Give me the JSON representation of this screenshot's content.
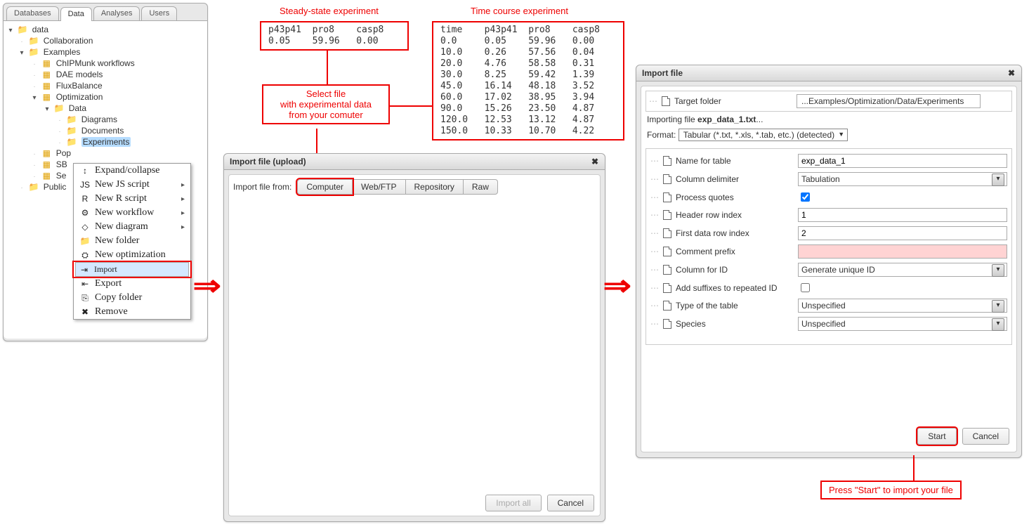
{
  "sidebar": {
    "tabs": [
      "Databases",
      "Data",
      "Analyses",
      "Users"
    ],
    "active_tab": "Data",
    "tree": {
      "root": "data",
      "nodes": {
        "collaboration": "Collaboration",
        "examples": "Examples",
        "chipmunk": "ChIPMunk workflows",
        "dae": "DAE models",
        "flux": "FluxBalance",
        "optimization": "Optimization",
        "data": "Data",
        "diagrams": "Diagrams",
        "documents": "Documents",
        "experiments": "Experiments",
        "pop": "Pop",
        "sb": "SB",
        "se": "Se",
        "public": "Public"
      }
    }
  },
  "context_menu": {
    "items": [
      {
        "label": "Expand/collapse",
        "icon": "↕"
      },
      {
        "label": "New JS script",
        "icon": "JS",
        "sub": true
      },
      {
        "label": "New R script",
        "icon": "R",
        "sub": true
      },
      {
        "label": "New workflow",
        "icon": "⚙",
        "sub": true
      },
      {
        "label": "New diagram",
        "icon": "◇",
        "sub": true
      },
      {
        "label": "New folder",
        "icon": "📁"
      },
      {
        "label": "New optimization",
        "icon": "⛭"
      },
      {
        "label": "Import",
        "icon": "⇥",
        "highlight": true
      },
      {
        "label": "Export",
        "icon": "⇤"
      },
      {
        "label": "Copy folder",
        "icon": "⎘"
      },
      {
        "label": "Remove",
        "icon": "✖"
      }
    ]
  },
  "steady_state": {
    "title": "Steady-state experiment",
    "header": [
      "p43p41",
      "pro8",
      "casp8"
    ],
    "row": [
      "0.05",
      "59.96",
      "0.00"
    ]
  },
  "time_course": {
    "title": "Time course experiment",
    "header": [
      "time",
      "p43p41",
      "pro8",
      "casp8"
    ],
    "rows": [
      [
        "0.0",
        "0.05",
        "59.96",
        "0.00"
      ],
      [
        "10.0",
        "0.26",
        "57.56",
        "0.04"
      ],
      [
        "20.0",
        "4.76",
        "58.58",
        "0.31"
      ],
      [
        "30.0",
        "8.25",
        "59.42",
        "1.39"
      ],
      [
        "45.0",
        "16.14",
        "48.18",
        "3.52"
      ],
      [
        "60.0",
        "17.02",
        "38.95",
        "3.94"
      ],
      [
        "90.0",
        "15.26",
        "23.50",
        "4.87"
      ],
      [
        "120.0",
        "12.53",
        "13.12",
        "4.87"
      ],
      [
        "150.0",
        "10.33",
        "10.70",
        "4.22"
      ]
    ]
  },
  "callout": {
    "line1": "Select file",
    "line2": "with experimental data",
    "line3": "from your comuter"
  },
  "upload": {
    "title": "Import file (upload)",
    "label": "Import file from:",
    "options": [
      "Computer",
      "Web/FTP",
      "Repository",
      "Raw"
    ],
    "btn_import_all": "Import all",
    "btn_cancel": "Cancel"
  },
  "settings": {
    "title": "Import file",
    "target_label": "Target folder",
    "target_value": "...Examples/Optimization/Data/Experiments",
    "importing_prefix": "Importing file ",
    "importing_file": "exp_data_1.txt",
    "importing_suffix": "...",
    "format_label": "Format:",
    "format_value": "Tabular (*.txt, *.xls, *.tab, etc.) (detected)",
    "fields": [
      {
        "label": "Name for table",
        "type": "text",
        "value": "exp_data_1"
      },
      {
        "label": "Column delimiter",
        "type": "select",
        "value": "Tabulation"
      },
      {
        "label": "Process quotes",
        "type": "check",
        "value": true
      },
      {
        "label": "Header row index",
        "type": "text",
        "value": "1"
      },
      {
        "label": "First data row index",
        "type": "text",
        "value": "2"
      },
      {
        "label": "Comment prefix",
        "type": "text",
        "value": "",
        "invalid": true
      },
      {
        "label": "Column for ID",
        "type": "select",
        "value": "Generate unique ID"
      },
      {
        "label": "Add suffixes to repeated ID",
        "type": "check",
        "value": false
      },
      {
        "label": "Type of the table",
        "type": "select",
        "value": "Unspecified"
      },
      {
        "label": "Species",
        "type": "select",
        "value": "Unspecified"
      }
    ],
    "btn_start": "Start",
    "btn_cancel": "Cancel"
  },
  "hint_start": "Press \"Start\" to import your file"
}
